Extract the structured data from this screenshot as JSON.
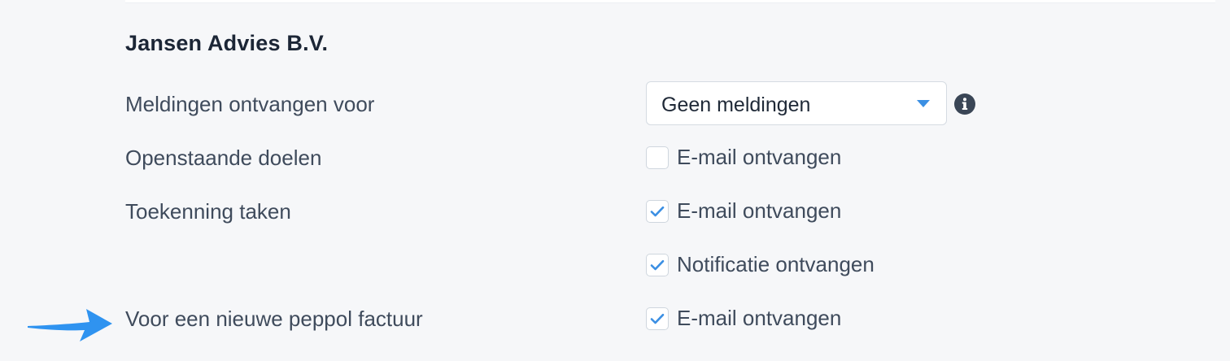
{
  "section": {
    "company": "Jansen Advies B.V."
  },
  "rows": {
    "meldingen": {
      "label": "Meldingen ontvangen voor",
      "select_value": "Geen meldingen"
    },
    "openstaande_doelen": {
      "label": "Openstaande doelen",
      "option_label": "E-mail ontvangen",
      "checked": false
    },
    "toekenning_taken": {
      "label": "Toekenning taken",
      "email_label": "E-mail ontvangen",
      "email_checked": true,
      "notificatie_label": "Notificatie ontvangen",
      "notificatie_checked": true
    },
    "peppol": {
      "label": "Voor een nieuwe peppol factuur",
      "option_label": "E-mail ontvangen",
      "checked": true
    }
  },
  "colors": {
    "accent": "#3b8fe3",
    "arrow": "#2f93f0",
    "info_icon": "#3a4656"
  },
  "icons": {
    "select_caret": "chevron-down-icon",
    "info": "info-icon",
    "check": "check-icon",
    "pointer": "arrow-right-icon"
  }
}
